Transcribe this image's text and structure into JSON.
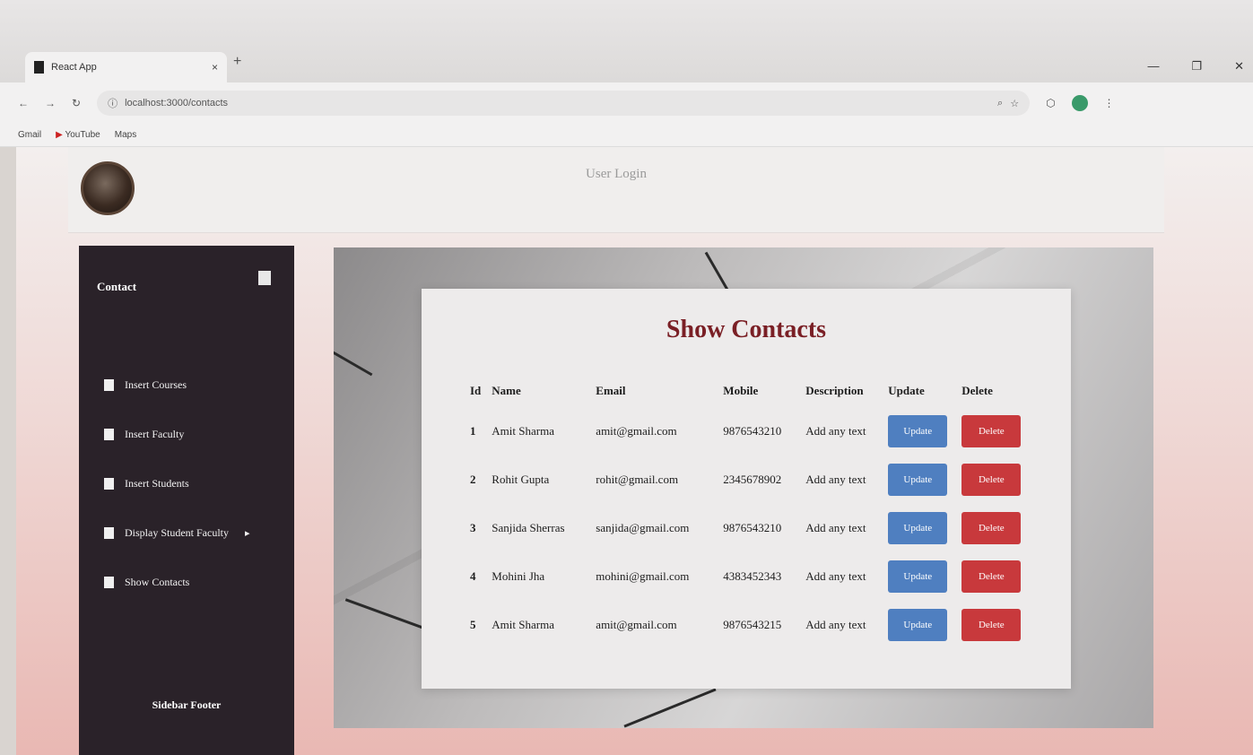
{
  "browser": {
    "tab_title": "React App",
    "tab_close": "×",
    "new_tab": "+",
    "url": "localhost:3000/contacts",
    "bookmarks": [
      {
        "label": "Gmail"
      },
      {
        "label": "YouTube"
      },
      {
        "label": "Maps"
      }
    ]
  },
  "header": {
    "title": "User Login"
  },
  "sidebar": {
    "heading": "Contact",
    "items": [
      {
        "label": "Insert Courses"
      },
      {
        "label": "Insert Faculty"
      },
      {
        "label": "Insert Students"
      },
      {
        "label": "Display Student Faculty",
        "arrow": "▸"
      },
      {
        "label": "Show Contacts"
      }
    ],
    "footer": "Sidebar Footer"
  },
  "main": {
    "title": "Show Contacts",
    "columns": [
      "Id",
      "Name",
      "Email",
      "Mobile",
      "Description",
      "Update",
      "Delete"
    ],
    "rows": [
      {
        "id": "1",
        "name": "Amit Sharma",
        "email": "amit@gmail.com",
        "mobile": "9876543210",
        "description": "Add any text",
        "update": "Update",
        "delete": "Delete"
      },
      {
        "id": "2",
        "name": "Rohit Gupta",
        "email": "rohit@gmail.com",
        "mobile": "2345678902",
        "description": "Add any text",
        "update": "Update",
        "delete": "Delete"
      },
      {
        "id": "3",
        "name": "Sanjida Sherras",
        "email": "sanjida@gmail.com",
        "mobile": "9876543210",
        "description": "Add any text",
        "update": "Update",
        "delete": "Delete"
      },
      {
        "id": "4",
        "name": "Mohini Jha",
        "email": "mohini@gmail.com",
        "mobile": "4383452343",
        "description": "Add any text",
        "update": "Update",
        "delete": "Delete"
      },
      {
        "id": "5",
        "name": "Amit Sharma",
        "email": "amit@gmail.com",
        "mobile": "9876543215",
        "description": "Add any text",
        "update": "Update",
        "delete": "Delete"
      }
    ]
  },
  "colors": {
    "sidebar_bg": "#2a2229",
    "title_color": "#7a1f25",
    "update_btn": "#4f7fc0",
    "delete_btn": "#c8393c"
  }
}
